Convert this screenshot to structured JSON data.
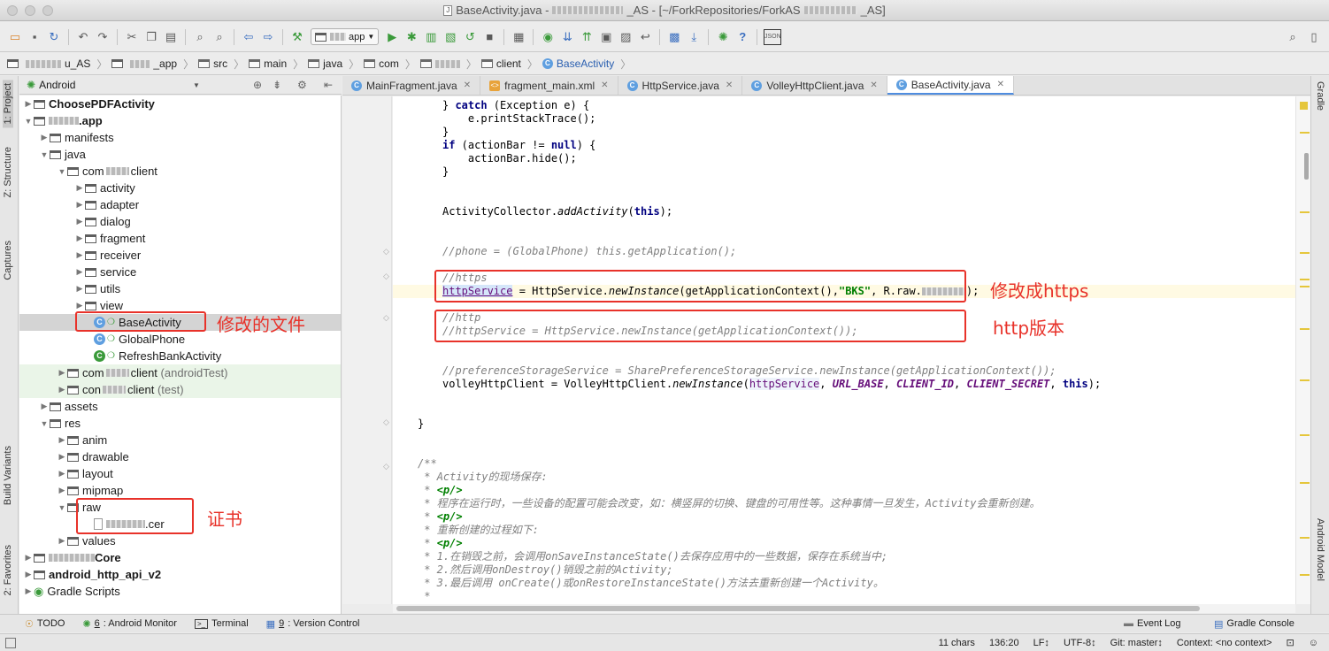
{
  "window": {
    "title": "BaseActivity.java - [~/ForkRepositories/ForkAS/_AS]",
    "title_prefix": "BaseActivity.java -",
    "title_mid": "_AS - [~/ForkRepositories/ForkAS",
    "title_suffix": "_AS]"
  },
  "toolbar": {
    "run_config": "app"
  },
  "breadcrumb": {
    "items": [
      "u_AS",
      "_app",
      "src",
      "main",
      "java",
      "com",
      "client",
      "BaseActivity"
    ]
  },
  "left_stripe": {
    "project": "1: Project",
    "structure": "Z: Structure",
    "captures": "Captures",
    "build_variants": "Build Variants",
    "favorites": "2: Favorites"
  },
  "right_stripe": {
    "gradle": "Gradle",
    "android_model": "Android Model"
  },
  "project_panel": {
    "view_mode": "Android",
    "tree": [
      {
        "label": "ChoosePDFActivity",
        "bold": true
      },
      {
        "label": ".app",
        "bold": true
      },
      {
        "label": "manifests"
      },
      {
        "label": "java"
      },
      {
        "label": "com",
        "suffix": "client"
      },
      {
        "label": "activity"
      },
      {
        "label": "adapter"
      },
      {
        "label": "dialog"
      },
      {
        "label": "fragment"
      },
      {
        "label": "receiver"
      },
      {
        "label": "service"
      },
      {
        "label": "utils"
      },
      {
        "label": "view"
      },
      {
        "label": "BaseActivity"
      },
      {
        "label": "GlobalPhone"
      },
      {
        "label": "RefreshBankActivity"
      },
      {
        "label": "com",
        "suffix": "client",
        "note": "(androidTest)"
      },
      {
        "label": "con",
        "suffix": "client",
        "note": "(test)"
      },
      {
        "label": "assets"
      },
      {
        "label": "res"
      },
      {
        "label": "anim"
      },
      {
        "label": "drawable"
      },
      {
        "label": "layout"
      },
      {
        "label": "mipmap"
      },
      {
        "label": "raw"
      },
      {
        "label": ".cer"
      },
      {
        "label": "values"
      },
      {
        "label": "Core",
        "bold": true
      },
      {
        "label": "android_http_api_v2",
        "bold": true
      },
      {
        "label": "Gradle Scripts"
      }
    ]
  },
  "editor_tabs": [
    {
      "label": "MainFragment.java"
    },
    {
      "label": "fragment_main.xml"
    },
    {
      "label": "HttpService.java"
    },
    {
      "label": "VolleyHttpClient.java"
    },
    {
      "label": "BaseActivity.java"
    }
  ],
  "code": {
    "l1a": "} ",
    "l1kw": "catch",
    "l1b": " (Exception e) {",
    "l2": "    e.printStackTrace();",
    "l3": "}",
    "l4kw": "if",
    "l4a": " (actionBar != ",
    "l4kw2": "null",
    "l4b": ") {",
    "l5": "    actionBar.hide();",
    "l6": "}",
    "l7a": "ActivityCollector.",
    "l7it": "addActivity",
    "l7b": "(",
    "l7kw": "this",
    "l7c": ");",
    "l8": "//phone = (GlobalPhone) this.getApplication();",
    "l9": "//https",
    "l10var": "httpService",
    "l10a": " = HttpService.",
    "l10it": "newInstance",
    "l10b": "(getApplicationContext(),",
    "l10str": "\"BKS\"",
    "l10c": ", R.raw.",
    "l10d": ");",
    "l11": "//http",
    "l12": "//httpService = HttpService.newInstance(getApplicationContext());",
    "l13": "//preferenceStorageService = SharePreferenceStorageService.newInstance(getApplicationContext());",
    "l14a": "volleyHttpClient",
    "l14b": " = VolleyHttpClient.",
    "l14it": "newInstance",
    "l14c": "(",
    "l14var": "httpService",
    "l14d": ", ",
    "l14f1": "URL_BASE",
    "l14e": ", ",
    "l14f2": "CLIENT_ID",
    "l14g": ", ",
    "l14f3": "CLIENT_SECRET",
    "l14h": ", ",
    "l14kw": "this",
    "l14i": ");",
    "l15": "}",
    "doc1": "/**",
    "doc2a": " * ",
    "doc2b": "Activity",
    "doc2c": "的现场保存:",
    "doc3a": " * ",
    "doc3tag": "<p/>",
    "doc4a": " * 程序在运行时，一些设备的配置可能会改变，如：横竖屏的切换、键盘的可用性等。这种事情一旦发生，",
    "doc4b": "Activity",
    "doc4c": "会重新创建。",
    "doc5a": " * ",
    "doc5tag": "<p/>",
    "doc6": " * 重新创建的过程如下:",
    "doc7a": " * ",
    "doc7tag": "<p/>",
    "doc8a": " * 1.在销毁之前，会调用",
    "doc8b": "onSaveInstanceState()",
    "doc8c": "去保存应用中的一些数据，保存在系统当中;",
    "doc9a": " * 2.然后调用",
    "doc9b": "onDestroy()",
    "doc9c": "销毁之前的",
    "doc9d": "Activity",
    "doc9e": ";",
    "doc10a": " * 3.最后调用 ",
    "doc10b": "onCreate()",
    "doc10c": "或",
    "doc10d": "onRestoreInstanceState()",
    "doc10e": "方法去重新创建一个",
    "doc10f": "Activity",
    "doc10g": "。",
    "doc11": " *"
  },
  "annotations": {
    "modified_file": "修改的文件",
    "https_change": "修改成https",
    "http_version": "http版本",
    "certificate": "证书"
  },
  "bottom_tools": {
    "todo": "TODO",
    "android_monitor_num": "6",
    "android_monitor": ": Android Monitor",
    "terminal": "Terminal",
    "vcs_num": "9",
    "vcs": ": Version Control",
    "event_log": "Event Log",
    "gradle_console": "Gradle Console"
  },
  "status": {
    "chars": "11 chars",
    "position": "136:20",
    "line_sep": "LF↕",
    "encoding": "UTF-8↕",
    "git": "Git: master↕",
    "context": "Context: <no context>"
  }
}
